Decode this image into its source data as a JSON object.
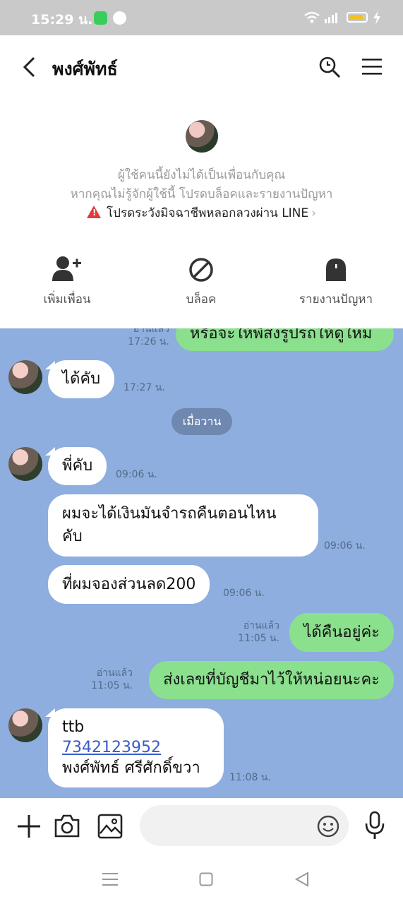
{
  "status_bar": {
    "time": "15:29 น.",
    "battery_level": 0.85
  },
  "header": {
    "title": "พงศ์พัทธ์",
    "icons": [
      "back-arrow-icon",
      "search-icon",
      "menu-icon"
    ]
  },
  "notice": {
    "line1": "ผู้ใช้คนนี้ยังไม่ได้เป็นเพื่อนกับคุณ",
    "line2": "หากคุณไม่รู้จักผู้ใช้นี้ โปรดบล็อคและรายงานปัญหา",
    "warning": "โปรดระวังมิจฉาชีพหลอกลวงผ่าน LINE"
  },
  "actions": [
    {
      "label": "เพิ่มเพื่อน",
      "icon": "add-friend-icon"
    },
    {
      "label": "บล็อค",
      "icon": "block-icon"
    },
    {
      "label": "รายงานปัญหา",
      "icon": "report-icon"
    }
  ],
  "chat": {
    "date_divider": "เมื่อวาน",
    "messages": [
      {
        "side": "me",
        "text": "หรือจะให้พี่ส่งรูปรถให้ดูใหม่",
        "read": "อ่านแล้ว",
        "time": "17:26 น."
      },
      {
        "side": "them",
        "text": "ได้คับ",
        "time": "17:27 น."
      },
      {
        "side": "them",
        "text": "พี่คับ",
        "time": "09:06 น."
      },
      {
        "side": "them",
        "text_lines": [
          "ผมจะได้เงินมันจำรถคืนตอนไหน",
          "คับ"
        ],
        "time": "09:06 น."
      },
      {
        "side": "them",
        "text": "ที่ผมจองส่วนลด200",
        "time": "09:06 น."
      },
      {
        "side": "me",
        "text": "ได้คืนอยู่ค่ะ",
        "read": "อ่านแล้ว",
        "time": "11:05 น."
      },
      {
        "side": "me",
        "text": "ส่งเลขที่บัญชีมาไว้ให้หน่อยนะคะ",
        "read": "อ่านแล้ว",
        "time": "11:05 น."
      },
      {
        "side": "them",
        "text_lines": [
          "ttb",
          "7342123952",
          "พงศ์พัทธ์ ศรีศักดิ์ขวา"
        ],
        "time": "11:08 น."
      }
    ]
  },
  "input": {
    "placeholder": "",
    "icons": [
      "plus-icon",
      "camera-icon",
      "image-icon",
      "emoji-icon",
      "microphone-icon"
    ]
  },
  "nav": {
    "icons": [
      "recent-apps-icon",
      "home-icon",
      "back-icon"
    ]
  }
}
